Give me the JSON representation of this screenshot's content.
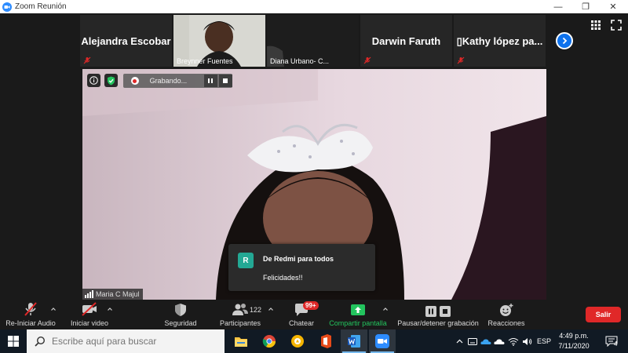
{
  "window": {
    "title": "Zoom Reunión"
  },
  "gallery": {
    "tiles": [
      {
        "name": "Alejandra Escobar",
        "muted": true
      },
      {
        "name": "Breynner Fuentes",
        "muted": false
      },
      {
        "name": "Diana Urbano- C...",
        "muted": false
      },
      {
        "name": "Darwin Faruth",
        "muted": true
      },
      {
        "name": "▯Kathy lópez pa...",
        "muted": true
      }
    ]
  },
  "main_video": {
    "recording_label": "Grabando...",
    "speaker_name": "Maria C Majul"
  },
  "chat_popup": {
    "avatar_letter": "R",
    "from": "De Redmi para todos",
    "message": "Felicidades!!"
  },
  "toolbar": {
    "audio_label": "Re-Iniciar Audio",
    "video_label": "Iniciar video",
    "security_label": "Seguridad",
    "participants_label": "Participantes",
    "participants_count": "122",
    "chat_label": "Chatear",
    "chat_badge": "99+",
    "share_label": "Compartir pantalla",
    "record_label": "Pausar/detener grabación",
    "reactions_label": "Reacciones",
    "leave_label": "Salir"
  },
  "taskbar": {
    "search_placeholder": "Escribe aquí para buscar",
    "language": "ESP",
    "time": "4:49 p.m.",
    "date": "7/11/2020",
    "notification_count": "4"
  },
  "colors": {
    "accent": "#0e72ed",
    "share_green": "#23c45e",
    "leave_red": "#e02828",
    "chat_avatar": "#23a894"
  }
}
